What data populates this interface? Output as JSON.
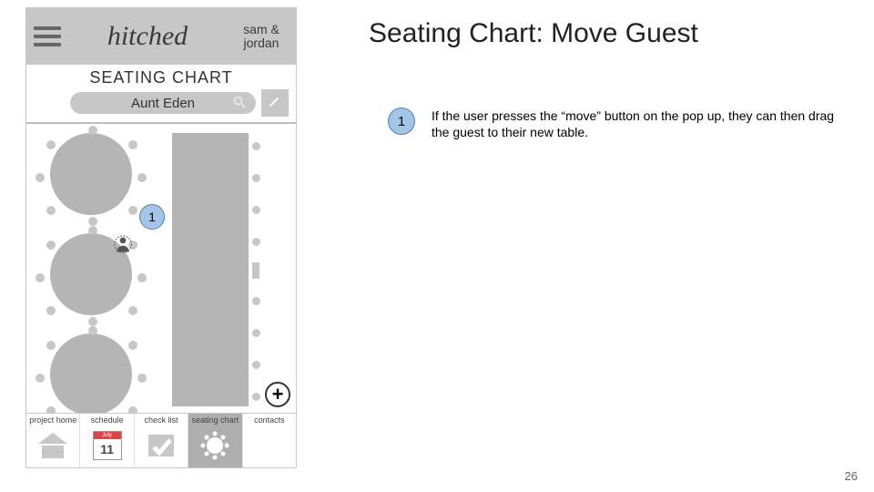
{
  "slide": {
    "title": "Seating Chart: Move Guest",
    "page_number": "26",
    "step_number": "1",
    "step_text": "If the user presses the “move” button on the pop up, they can then drag the guest to their new table."
  },
  "app": {
    "brand": "hitched",
    "couple_line1": "sam &",
    "couple_line2": "jordan",
    "page_label": "SEATING CHART",
    "search_value": "Aunt Eden",
    "add_label": "+",
    "callout_label": "1"
  },
  "nav": {
    "items": [
      {
        "label": "project home"
      },
      {
        "label": "schedule",
        "cal_month": "July",
        "cal_day": "11"
      },
      {
        "label": "check list"
      },
      {
        "label": "seating chart"
      },
      {
        "label": "contacts"
      }
    ]
  }
}
